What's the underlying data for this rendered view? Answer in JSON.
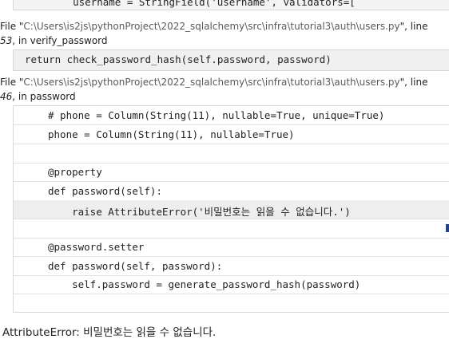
{
  "frames": {
    "top_code": "    username = StringField('username', validators=[",
    "frame1": {
      "file_prefix": "File \"",
      "file_path": "C:\\Users\\is2js\\pythonProject\\2022_sqlalchemy\\src\\infra\\tutorial3\\auth\\users.py",
      "file_suffix": "\", line",
      "lineno": "53",
      "in_text": ", in verify_password",
      "code": "return check_password_hash(self.password, password)"
    },
    "frame2": {
      "file_prefix": "File \"",
      "file_path": "C:\\Users\\is2js\\pythonProject\\2022_sqlalchemy\\src\\infra\\tutorial3\\auth\\users.py",
      "file_suffix": "\", line",
      "lineno": "46",
      "in_text": ", in password",
      "lines": [
        "# phone = Column(String(11), nullable=True, unique=True)",
        "phone = Column(String(11), nullable=True)",
        "",
        "@property",
        "def password(self):",
        "    raise AttributeError('비밀번호는 읽을 수 없습니다.')",
        "",
        "@password.setter",
        "def password(self, password):",
        "    self.password = generate_password_hash(password)",
        ""
      ]
    }
  },
  "error_message": "AttributeError: 비밀번호는 읽을 수 없습니다."
}
